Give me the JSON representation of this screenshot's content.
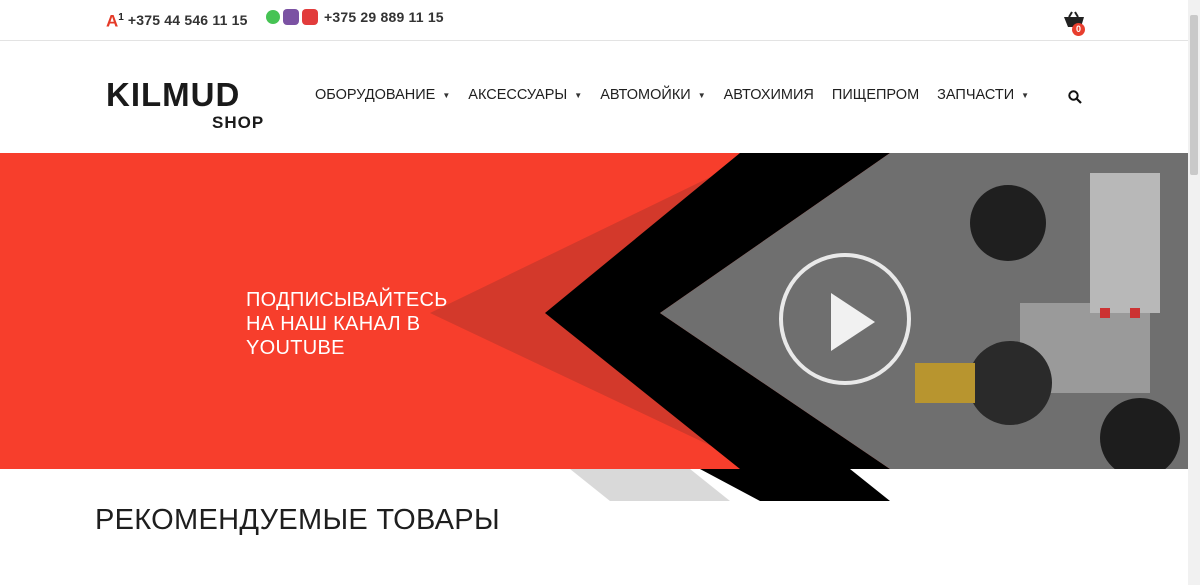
{
  "topbar": {
    "operator_logo": "A",
    "operator_logo_sup": "1",
    "phone_a1": "+375 44 546 11 15",
    "phone_mts": "+375 29 889 11 15",
    "messengers": [
      "whatsapp-icon",
      "viber-icon",
      "other-messenger-icon"
    ],
    "cart_count": "0"
  },
  "header": {
    "logo_main": "KILMUD",
    "logo_sub": "SHOP",
    "nav": [
      {
        "label": "ОБОРУДОВАНИЕ",
        "has_dropdown": true
      },
      {
        "label": "АКСЕССУАРЫ",
        "has_dropdown": true
      },
      {
        "label": "АВТОМОЙКИ",
        "has_dropdown": true
      },
      {
        "label": "АВТОХИМИЯ",
        "has_dropdown": false
      },
      {
        "label": "ПИЩЕПРОМ",
        "has_dropdown": false
      },
      {
        "label": "ЗАПЧАСТИ",
        "has_dropdown": true
      }
    ],
    "caret": "▼"
  },
  "banner": {
    "line1": "ПОДПИСЫВАЙТЕСЬ",
    "line2": "НА НАШ КАНАЛ В",
    "line3": "YOUTUBE"
  },
  "main": {
    "section_title": "РЕКОМЕНДУЕМЫЕ ТОВАРЫ"
  },
  "colors": {
    "accent": "#f73e2c",
    "dark": "#000000"
  }
}
